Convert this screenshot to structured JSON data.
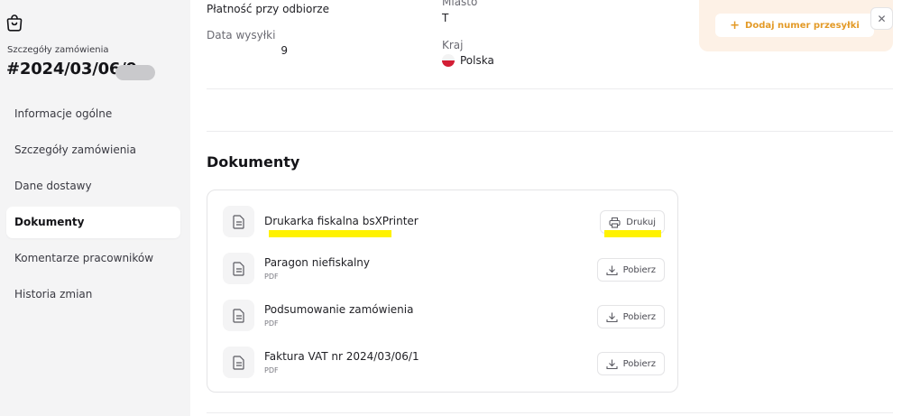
{
  "sidebar": {
    "order_caption": "Szczegóły zamówienia",
    "order_number": "#2024/03/06/9",
    "nav": [
      {
        "label": "Informacje ogólne",
        "active": false
      },
      {
        "label": "Szczegóły zamówienia",
        "active": false
      },
      {
        "label": "Dane dostawy",
        "active": false
      },
      {
        "label": "Dokumenty",
        "active": true
      },
      {
        "label": "Komentarze pracowników",
        "active": false
      },
      {
        "label": "Historia zmian",
        "active": false
      }
    ]
  },
  "details": {
    "payment_value": "Płatność przy odbiorze",
    "ship_date_label": "Data wysyłki",
    "ship_date_value": "9",
    "city_label": "Miasto",
    "city_value": "T",
    "country_label": "Kraj",
    "country_value": "Polska"
  },
  "shipment": {
    "add_label": "Dodaj numer przesyłki",
    "close_glyph": "✕"
  },
  "documents": {
    "title": "Dokumenty",
    "items": [
      {
        "name": "Drukarka fiskalna bsXPrinter",
        "sub": "",
        "action": "Drukuj",
        "icon": "printer-icon"
      },
      {
        "name": "Paragon niefiskalny",
        "sub": "PDF",
        "action": "Pobierz",
        "icon": "download-icon"
      },
      {
        "name": "Podsumowanie zamówienia",
        "sub": "PDF",
        "action": "Pobierz",
        "icon": "download-icon"
      },
      {
        "name": "Faktura VAT nr 2024/03/06/1",
        "sub": "PDF",
        "action": "Pobierz",
        "icon": "download-icon"
      }
    ]
  },
  "colors": {
    "accent": "#e39a27",
    "highlight": "#fff200",
    "sidebar_bg": "#f4f4f5"
  }
}
